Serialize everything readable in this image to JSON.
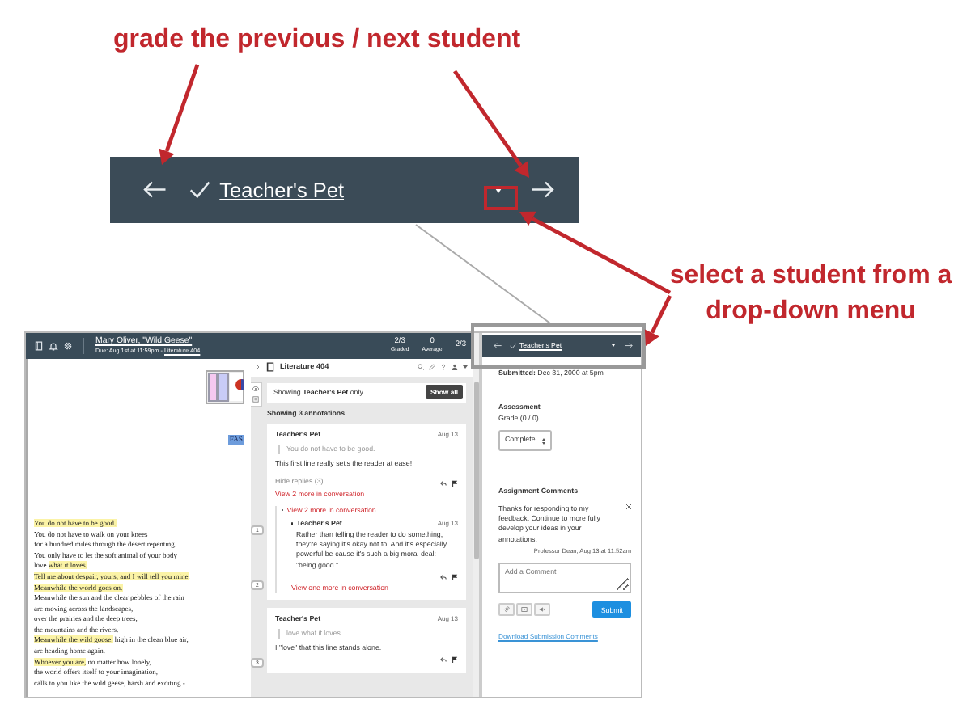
{
  "callouts": [
    {
      "text": "grade the previous / next student"
    },
    {
      "text": "select a student from a drop-down menu"
    }
  ],
  "zoomed_student_bar": {
    "student": "Teacher's Pet",
    "graded": true
  },
  "header": {
    "title": "Mary Oliver, \"Wild Geese\"",
    "due": "Due: Aug 1st at 11:59pm -",
    "course_link": "Literature 404",
    "stats": [
      {
        "value": "2/3",
        "label": "Graded"
      },
      {
        "value": "0",
        "label": "Average"
      }
    ],
    "position": "2/3"
  },
  "document": {
    "tag": "FAS",
    "lines": [
      {
        "segments": [
          {
            "text": "You do not have to be good.",
            "highlighted": true
          }
        ]
      },
      {
        "segments": [
          {
            "text": "You do not have to walk on your knees",
            "highlighted": false
          }
        ]
      },
      {
        "segments": [
          {
            "text": "for a hundred miles through the desert repenting.",
            "highlighted": false
          }
        ]
      },
      {
        "segments": [
          {
            "text": "You only have to let the soft animal of your body",
            "highlighted": false
          }
        ]
      },
      {
        "segments": [
          {
            "text": "love ",
            "highlighted": false
          },
          {
            "text": "what it loves.",
            "highlighted": true
          }
        ]
      },
      {
        "segments": [
          {
            "text": "Tell me about despair, yours, and I will tell you mine.",
            "highlighted": true
          }
        ]
      },
      {
        "segments": [
          {
            "text": "Meanwhile the world goes on.",
            "highlighted": true
          }
        ]
      },
      {
        "segments": [
          {
            "text": "Meanwhile the sun and the clear pebbles of the rain",
            "highlighted": false
          }
        ]
      },
      {
        "segments": [
          {
            "text": "are moving across the landscapes,",
            "highlighted": false
          }
        ]
      },
      {
        "segments": [
          {
            "text": "over the prairies and the deep trees,",
            "highlighted": false
          }
        ]
      },
      {
        "segments": [
          {
            "text": "the mountains and the rivers.",
            "highlighted": false
          }
        ]
      },
      {
        "segments": [
          {
            "text": "Meanwhile the wild goose,",
            "highlighted": true
          },
          {
            "text": " high in the clean blue air,",
            "highlighted": false
          }
        ]
      },
      {
        "segments": [
          {
            "text": "are heading home again.",
            "highlighted": false
          }
        ]
      },
      {
        "segments": [
          {
            "text": "Whoever you are,",
            "highlighted": true
          },
          {
            "text": " no matter how lonely,",
            "highlighted": false
          }
        ]
      },
      {
        "segments": [
          {
            "text": "the world offers itself to your imagination,",
            "highlighted": false
          }
        ]
      },
      {
        "segments": [
          {
            "text": "calls to you like the wild geese, harsh and exciting -",
            "highlighted": false
          }
        ]
      }
    ]
  },
  "annotation_panel": {
    "course": "Literature 404",
    "filter": "Showing **Teacher's Pet** only",
    "show_all": "Show all",
    "count": "Showing 3 annotations",
    "markers": [
      "1",
      "2",
      "3"
    ],
    "annotations": [
      {
        "author": "Teacher's Pet",
        "date": "Aug 13",
        "quote": "You do not have to be good.",
        "body": "This first line really set's the reader at ease!",
        "hide_replies": "Hide replies (3)",
        "more": "View 2 more in conversation",
        "thread": {
          "more": "View 2 more in conversation",
          "author": "Teacher's Pet",
          "date": "Aug 13",
          "body": "Rather than telling the reader to do something, they're saying it's okay not to. And it's especially powerful be-cause it's such a big moral deal: \"being good.\"",
          "more_after": "View one more in conversation"
        }
      },
      {
        "author": "Teacher's Pet",
        "date": "Aug 13",
        "quote": "love what it loves.",
        "body": "I \"love\" that this line stands alone."
      }
    ]
  },
  "grading_panel": {
    "student_bar": {
      "student": "Teacher's Pet",
      "graded": true
    },
    "submitted": "**Submitted:** Dec 31, 2000 at 5pm",
    "assessment": "Assessment",
    "grade": "Grade (0 / 0)",
    "grade_value": "Complete",
    "comments_heading": "Assignment Comments",
    "comments": [
      {
        "text": "Thanks for responding to my feedback. Continue to more fully develop your ideas in your annotations.",
        "byline": "Professor Dean, Aug 13 at 11:52am"
      }
    ],
    "comment_placeholder": "Add a Comment",
    "submit": "Submit",
    "download_link": "Download Submission Comments"
  }
}
